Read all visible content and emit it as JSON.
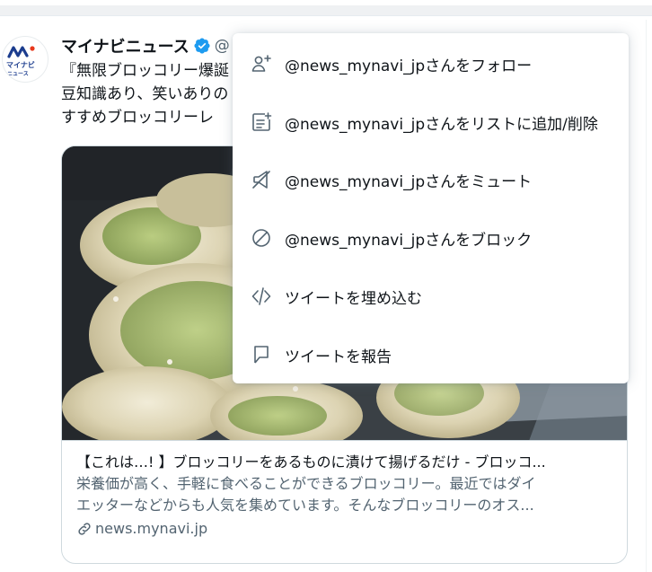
{
  "tweet": {
    "author_name": "マイナビニュース",
    "author_handle_partial": "@",
    "verified": true,
    "avatar_logo_line1": "マイナビ",
    "avatar_logo_line2": "ニュース",
    "text_lines": [
      "『無限ブロッコリー爆誕",
      "豆知識あり、笑いありの",
      "すすめブロッコリーレ"
    ]
  },
  "card": {
    "title": "【これは…! 】ブロッコリーをあるものに漬けて揚げるだけ - ブロッコ...",
    "description_lines": [
      "栄養価が高く、手軽に食べることができるブロッコリー。最近ではダイ",
      "エッターなどからも人気を集めています。そんなブロッコリーのオス..."
    ],
    "domain": "news.mynavi.jp",
    "domain_icon": "link-icon"
  },
  "menu": {
    "items": [
      {
        "label": "@news_mynavi_jpさんをフォロー",
        "icon": "follow-user-icon"
      },
      {
        "label": "@news_mynavi_jpさんをリストに追加/削除",
        "icon": "add-to-list-icon"
      },
      {
        "label": "@news_mynavi_jpさんをミュート",
        "icon": "mute-icon"
      },
      {
        "label": "@news_mynavi_jpさんをブロック",
        "icon": "block-icon"
      },
      {
        "label": "ツイートを埋め込む",
        "icon": "embed-code-icon"
      },
      {
        "label": "ツイートを報告",
        "icon": "report-flag-icon"
      }
    ]
  },
  "colors": {
    "text_primary": "#0f1419",
    "text_secondary": "#536471",
    "verified_blue": "#1d9bf0",
    "border": "#cfd9de",
    "brand_logo": "#1b3c8e"
  }
}
